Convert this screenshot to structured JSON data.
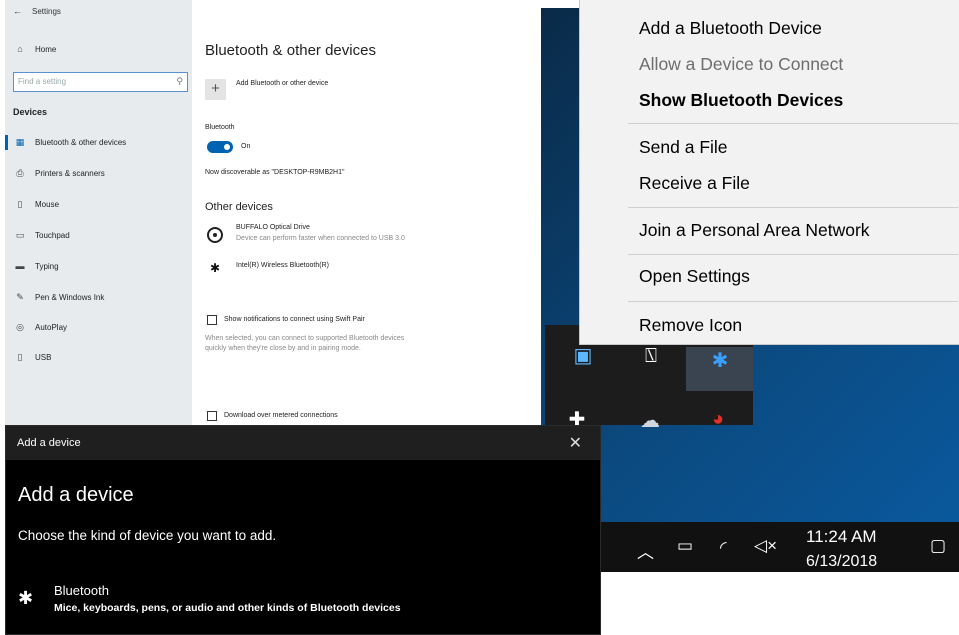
{
  "settings": {
    "title": "Settings",
    "back_glyph": "←",
    "sidebar": {
      "home": "Home",
      "search_placeholder": "Find a setting",
      "section": "Devices",
      "items": [
        {
          "label": "Bluetooth & other devices",
          "icon": "bluetooth-devices-icon"
        },
        {
          "label": "Printers & scanners",
          "icon": "printer-icon"
        },
        {
          "label": "Mouse",
          "icon": "mouse-icon"
        },
        {
          "label": "Touchpad",
          "icon": "touchpad-icon"
        },
        {
          "label": "Typing",
          "icon": "keyboard-icon"
        },
        {
          "label": "Pen & Windows Ink",
          "icon": "pen-icon"
        },
        {
          "label": "AutoPlay",
          "icon": "autoplay-icon"
        },
        {
          "label": "USB",
          "icon": "usb-icon"
        }
      ]
    },
    "content": {
      "heading": "Bluetooth & other devices",
      "add_label": "Add Bluetooth or other device",
      "bluetooth_label": "Bluetooth",
      "toggle_state": "On",
      "discoverable": "Now discoverable as \"DESKTOP-R9MB2H1\"",
      "other_devices": "Other devices",
      "devices": [
        {
          "name": "BUFFALO Optical Drive",
          "detail": "Device can perform faster when connected to USB 3.0"
        },
        {
          "name": "Intel(R) Wireless Bluetooth(R)",
          "detail": ""
        }
      ],
      "swift_pair_label": "Show notifications to connect using Swift Pair",
      "swift_pair_desc_1": "When selected, you can connect to supported Bluetooth devices",
      "swift_pair_desc_2": "quickly when they're close by and in pairing mode.",
      "metered_label": "Download over metered connections"
    }
  },
  "dialog": {
    "title": "Add a device",
    "close_glyph": "✕",
    "heading": "Add a device",
    "subtitle": "Choose the kind of device you want to add.",
    "option_title": "Bluetooth",
    "option_desc": "Mice, keyboards, pens, or audio and other kinds of Bluetooth devices"
  },
  "context_menu": {
    "items": [
      {
        "label": "Add a Bluetooth Device",
        "state": "normal"
      },
      {
        "label": "Allow a Device to Connect",
        "state": "disabled"
      },
      {
        "label": "Show Bluetooth Devices",
        "state": "default"
      },
      {
        "label": "Send a File",
        "state": "normal"
      },
      {
        "label": "Receive a File",
        "state": "normal"
      },
      {
        "label": "Join a Personal Area Network",
        "state": "normal"
      },
      {
        "label": "Open Settings",
        "state": "normal"
      },
      {
        "label": "Remove Icon",
        "state": "normal"
      }
    ]
  },
  "taskbar": {
    "time": "11:24 AM",
    "date": "6/13/2018"
  },
  "colors": {
    "accent": "#0063b1",
    "dialog_bg": "#000000",
    "menu_bg": "#f2f2f2"
  }
}
